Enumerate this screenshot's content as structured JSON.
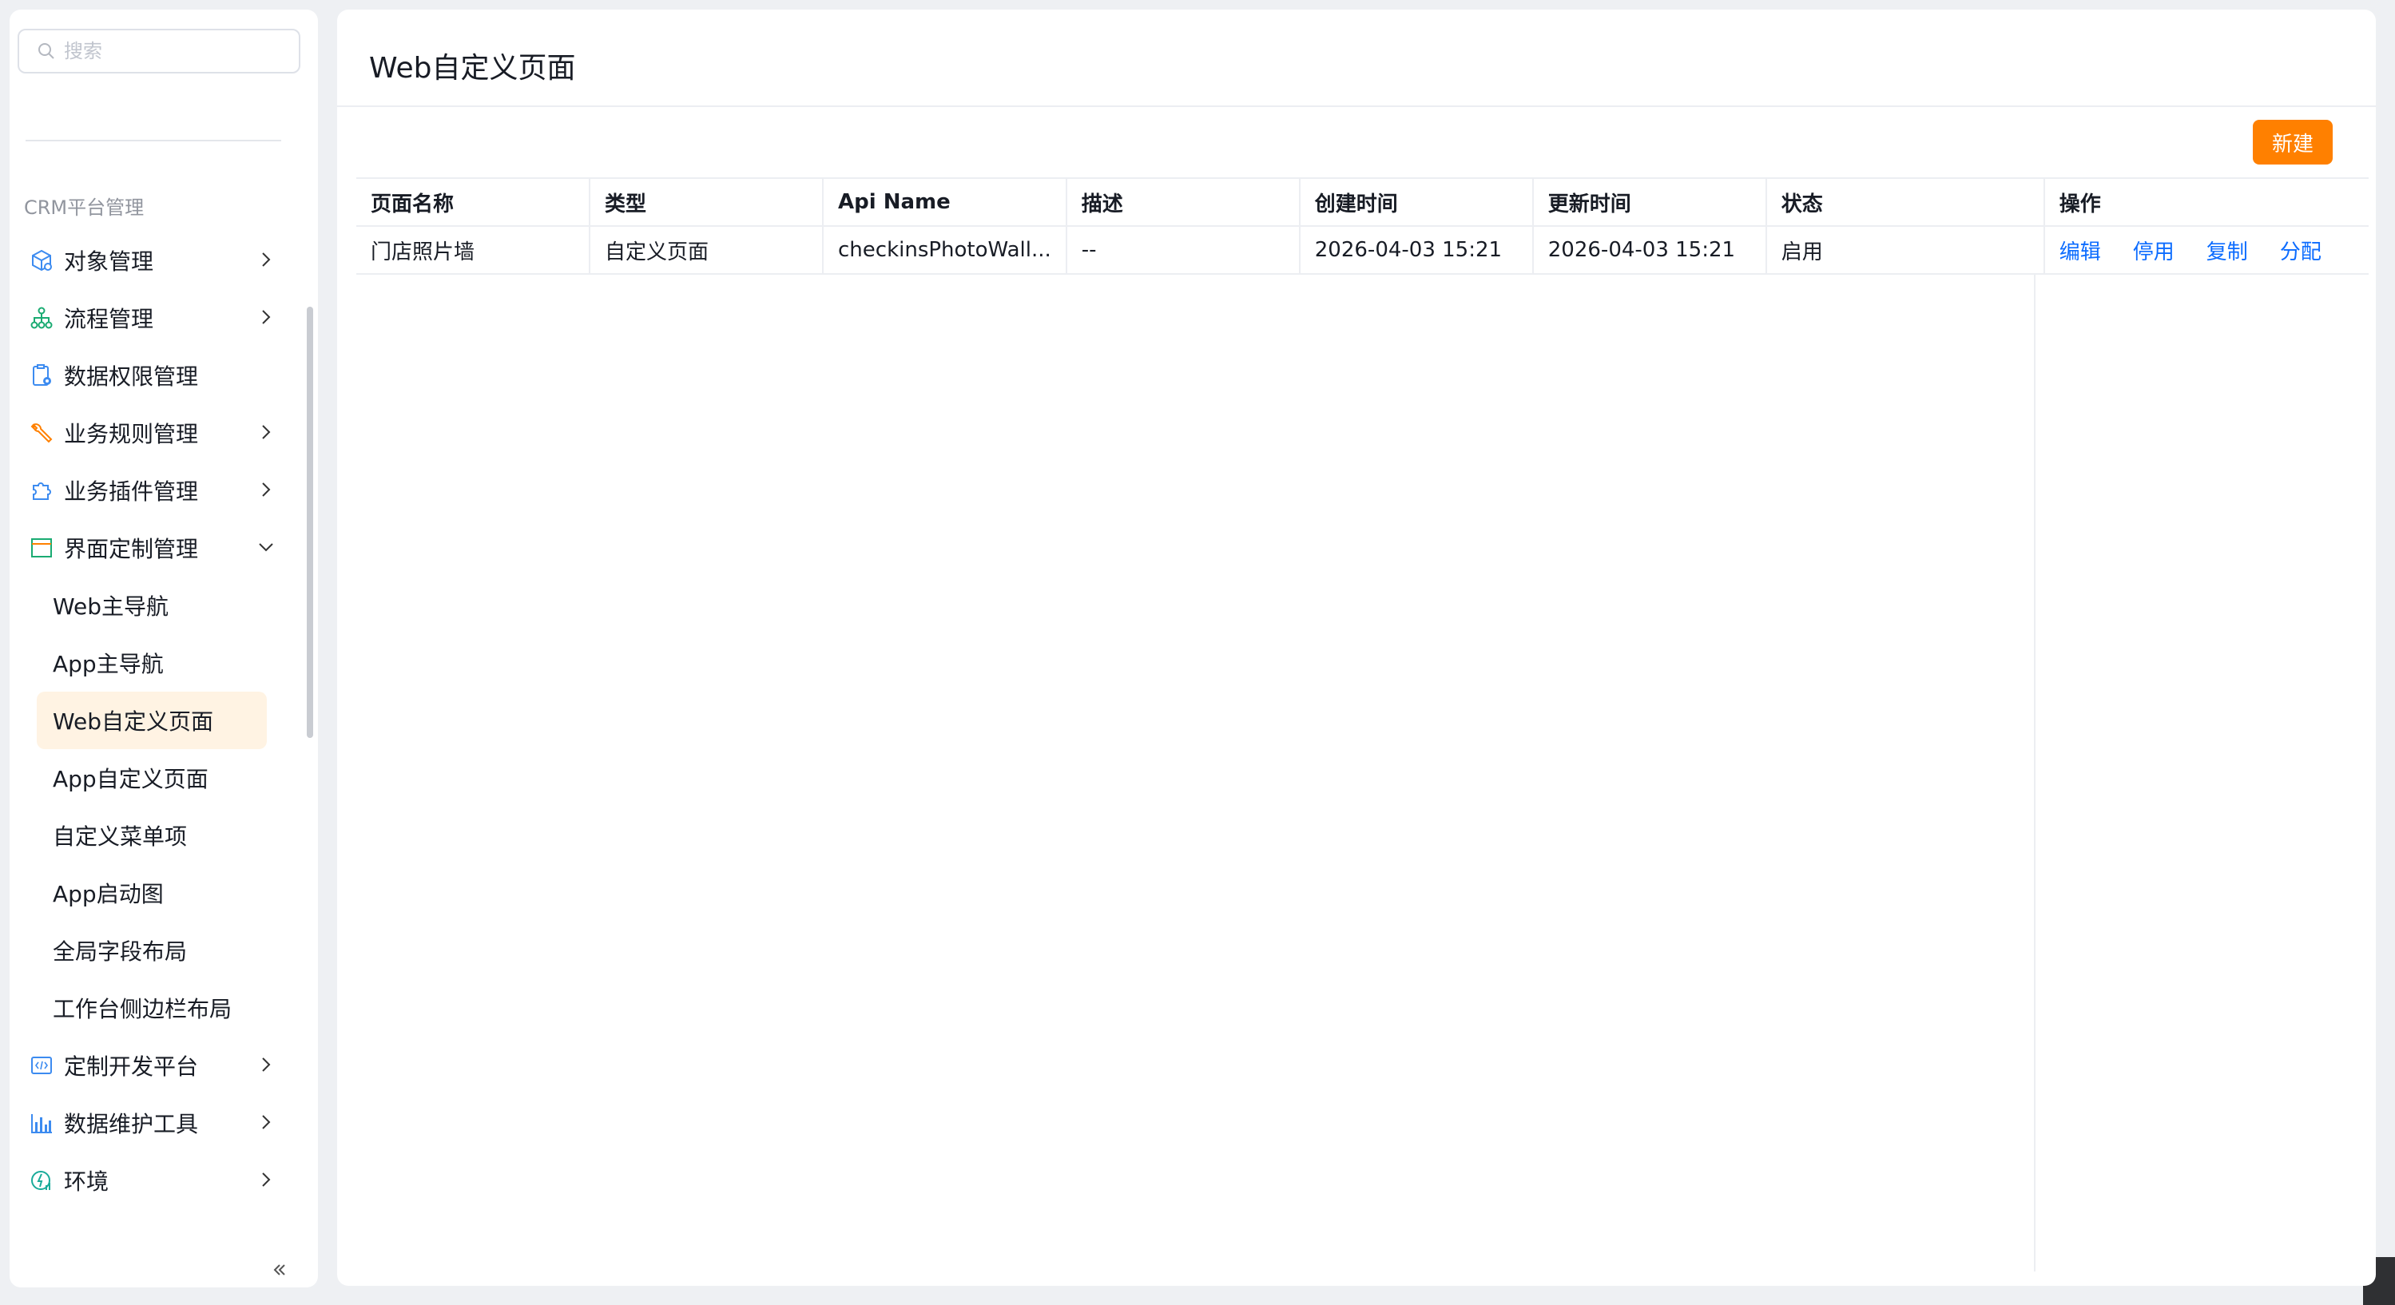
{
  "sidebar": {
    "search_placeholder": "搜索",
    "section_title": "CRM平台管理",
    "items": [
      {
        "label": "对象管理"
      },
      {
        "label": "流程管理"
      },
      {
        "label": "数据权限管理"
      },
      {
        "label": "业务规则管理"
      },
      {
        "label": "业务插件管理"
      },
      {
        "label": "界面定制管理"
      },
      {
        "label": "定制开发平台"
      },
      {
        "label": "数据维护工具"
      },
      {
        "label": "环境"
      }
    ],
    "sub_items": [
      {
        "label": "Web主导航"
      },
      {
        "label": "App主导航"
      },
      {
        "label": "Web自定义页面"
      },
      {
        "label": "App自定义页面"
      },
      {
        "label": "自定义菜单项"
      },
      {
        "label": "App启动图"
      },
      {
        "label": "全局字段布局"
      },
      {
        "label": "工作台侧边栏布局"
      }
    ]
  },
  "main": {
    "title": "Web自定义页面",
    "new_button": "新建",
    "columns": [
      "页面名称",
      "类型",
      "Api Name",
      "描述",
      "创建时间",
      "更新时间",
      "状态",
      "操作"
    ],
    "rows": [
      {
        "name": "门店照片墙",
        "type": "自定义页面",
        "api_name": "checkinsPhotoWall...",
        "description": "--",
        "created": "2026-04-03 15:21",
        "updated": "2026-04-03 15:21",
        "status": "启用",
        "actions": [
          "编辑",
          "停用",
          "复制",
          "分配"
        ]
      }
    ]
  },
  "colors": {
    "accent": "#ff8000",
    "link": "#0c6cff",
    "active_bg": "#fff3e3"
  }
}
